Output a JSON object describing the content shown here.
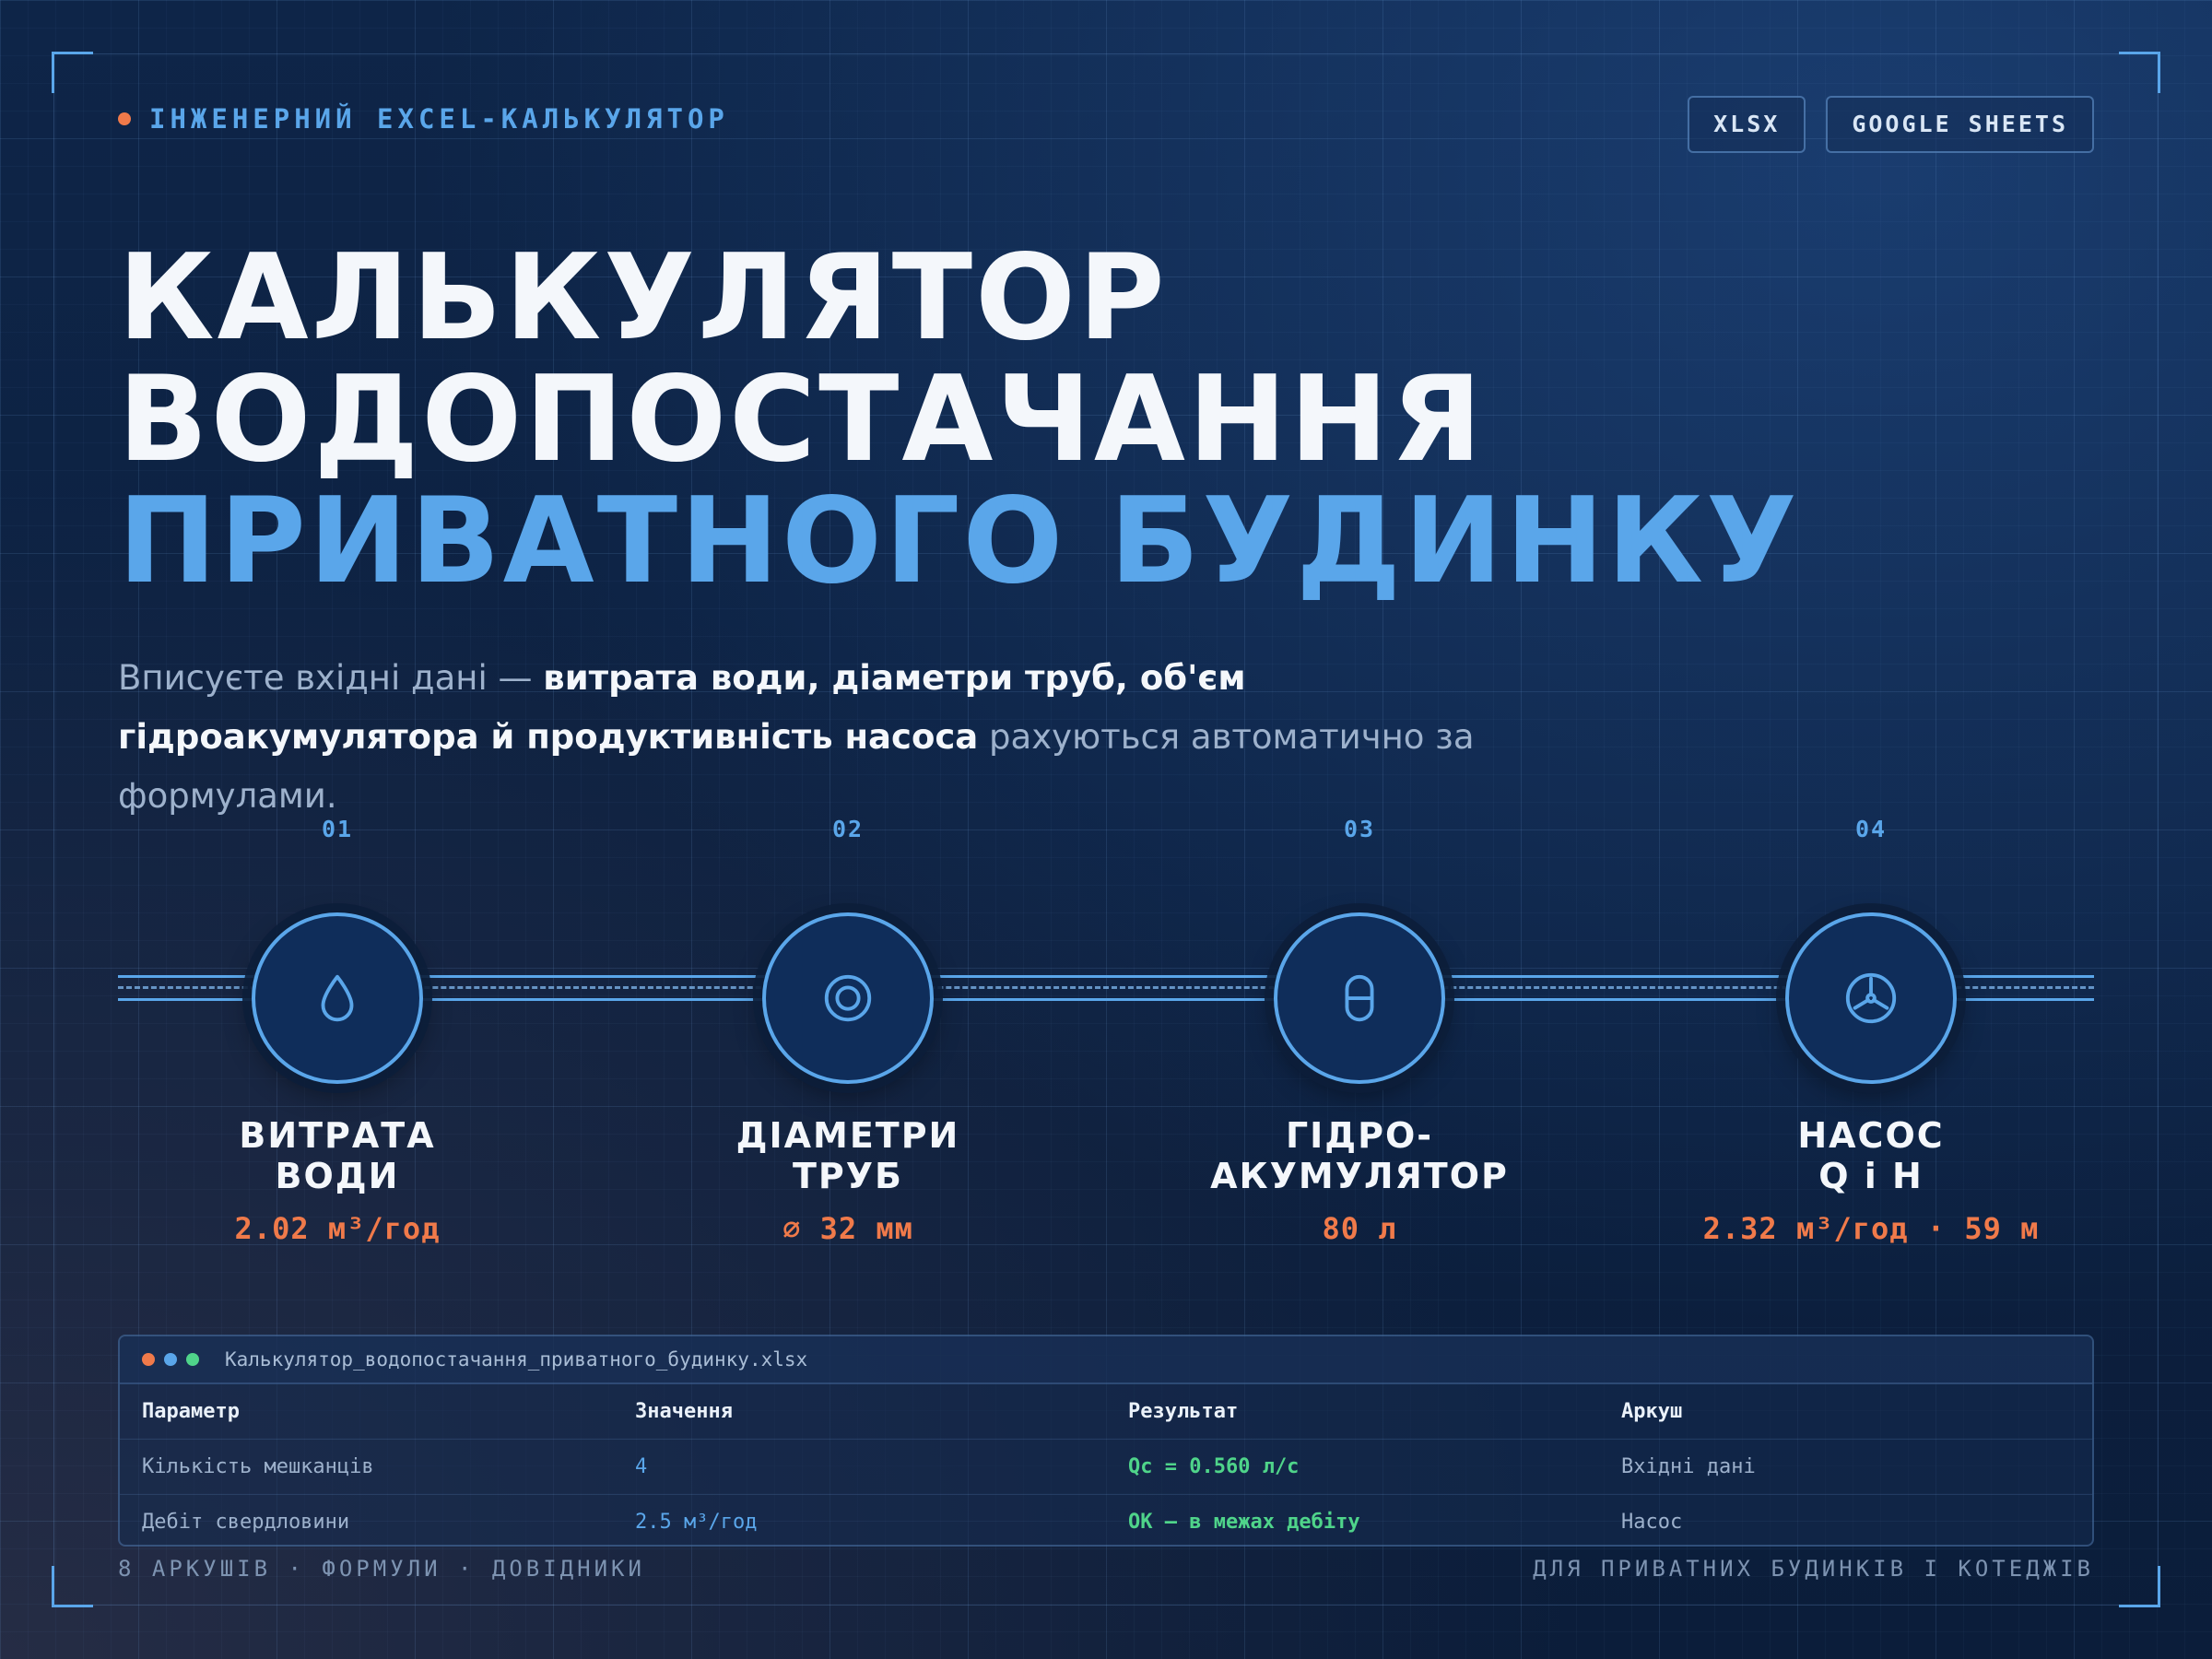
{
  "brand": {
    "label": "ІНЖЕНЕРНИЙ EXCEL-КАЛЬКУЛЯТОР"
  },
  "badges": [
    "XLSX",
    "GOOGLE SHEETS"
  ],
  "title": {
    "line1": "КАЛЬКУЛЯТОР",
    "line2": "ВОДОПОСТАЧАННЯ",
    "line3": "ПРИВАТНОГО БУДИНКУ"
  },
  "subtitle": {
    "part1": "Вписуєте вхідні дані — ",
    "bold1": "витрата води, діаметри труб, об'єм гідроакумулятора й продуктивність насоса",
    "part2": " рахуються автоматично за формулами."
  },
  "steps": [
    {
      "num": "01",
      "icon": "water-drop-icon",
      "label1": "ВИТРАТА",
      "label2": "ВОДИ",
      "value": "2.02 м³/год"
    },
    {
      "num": "02",
      "icon": "pipe-diameter-icon",
      "label1": "ДІАМЕТРИ",
      "label2": "ТРУБ",
      "value": "⌀ 32 мм"
    },
    {
      "num": "03",
      "icon": "tank-icon",
      "label1": "ГІДРО-",
      "label2": "АКУМУЛЯТОР",
      "value": "80 л"
    },
    {
      "num": "04",
      "icon": "pump-fan-icon",
      "label1": "НАСОС",
      "label2": "Q і H",
      "value": "2.32 м³/год · 59 м"
    }
  ],
  "spreadsheet": {
    "filename": "Калькулятор_водопостачання_приватного_будинку.xlsx",
    "window_dots": [
      "#f07a4a",
      "#5aa6ea",
      "#4fd48a"
    ],
    "headers": [
      "Параметр",
      "Значення",
      "Результат",
      "Аркуш"
    ],
    "rows": [
      [
        "Кількість мешканців",
        "4",
        "Qc = 0.560 л/с",
        "Вхідні дані"
      ],
      [
        "Дебіт свердловини",
        "2.5 м³/год",
        "OK — в межах дебіту",
        "Насос"
      ]
    ]
  },
  "footer": {
    "left": "8 АРКУШІВ · ФОРМУЛИ · ДОВІДНИКИ",
    "right": "ДЛЯ ПРИВАТНИХ БУДИНКІВ І КОТЕДЖІВ"
  },
  "colors": {
    "accent": "#5aa6ea",
    "orange": "#f07a4a",
    "green": "#4fd48a",
    "background": "#0c1e3a"
  }
}
